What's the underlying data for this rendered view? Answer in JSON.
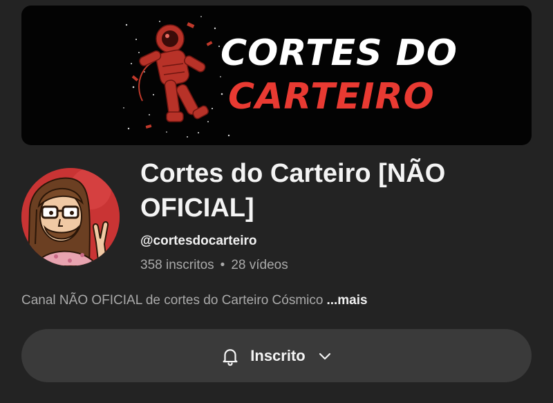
{
  "banner": {
    "title_line1": "CORTES DO",
    "title_line2": "CARTEIRO",
    "title_line1_color": "#ffffff",
    "title_line2_color": "#e93a32",
    "art_icon": "astronaut-illustration"
  },
  "channel": {
    "name": "Cortes do Carteiro [NÃO OFICIAL]",
    "handle": "@cortesdocarteiro",
    "subscribers": "358 inscritos",
    "separator": "•",
    "videos": "28 vídeos",
    "description": "Canal NÃO OFICIAL de cortes do Carteiro Cósmico",
    "more_label": "...mais",
    "avatar_icon": "cartoon-avatar"
  },
  "subscribe_button": {
    "label": "Inscrito",
    "icon": "bell-icon",
    "dropdown_icon": "chevron-down-icon",
    "background": "#3a3a3a"
  }
}
